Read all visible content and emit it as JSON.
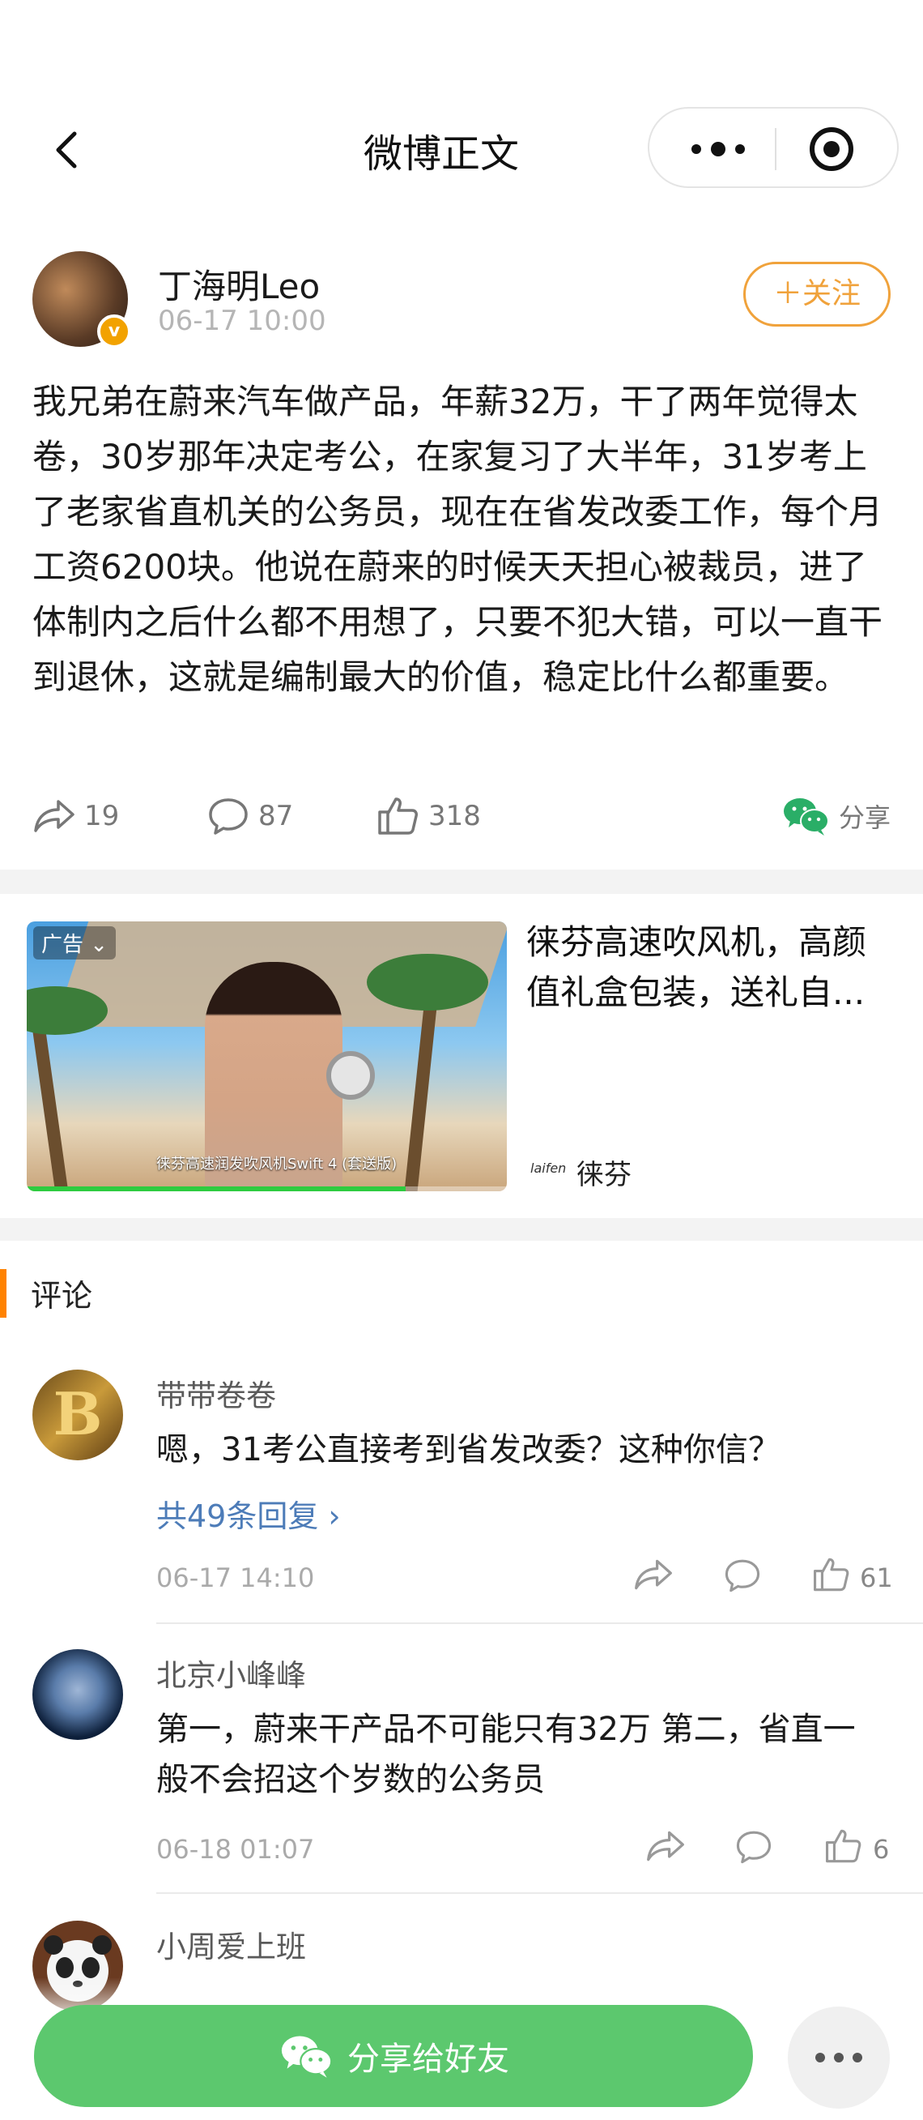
{
  "header": {
    "title": "微博正文"
  },
  "post": {
    "author": "丁海明Leo",
    "time": "06-17 10:00",
    "follow_label": "＋关注",
    "text": "我兄弟在蔚来汽车做产品，年薪32万，干了两年觉得太卷，30岁那年决定考公，在家复习了大半年，31岁考上了老家省直机关的公务员，现在在省发改委工作，每个月工资6200块。他说在蔚来的时候天天担心被裁员，进了体制内之后什么都不用想了，只要不犯大错，可以一直干到退休，这就是编制最大的价值，稳定比什么都重要。",
    "reposts": "19",
    "comments": "87",
    "likes": "318",
    "share_label": "分享"
  },
  "ad": {
    "tag": "广告",
    "image_caption": "徕芬高速润发吹风机Swift 4 (套送版)",
    "progress": 0.79,
    "title": "徕芬高速吹风机，高颜值礼盒包装，送礼自...",
    "brand_logo": "laifen",
    "brand": "徕芬"
  },
  "comments_section": {
    "title": "评论",
    "items": [
      {
        "name": "带带卷卷",
        "text": "嗯，31考公直接考到省发改委？这种你信？",
        "replies": "共49条回复 ›",
        "time": "06-17 14:10",
        "likes": "61"
      },
      {
        "name": "北京小峰峰",
        "text": "第一，蔚来干产品不可能只有32万 第二，省直一般不会招这个岁数的公务员",
        "time": "06-18 01:07",
        "likes": "6"
      },
      {
        "name": "小周爱上班",
        "text": ""
      }
    ]
  },
  "footer": {
    "share_friends_label": "分享给好友"
  },
  "colors": {
    "accent": "#ff8200",
    "follow": "#f0a23b",
    "wechat_green": "#5cc86e",
    "link_blue": "#4d7cb8"
  }
}
